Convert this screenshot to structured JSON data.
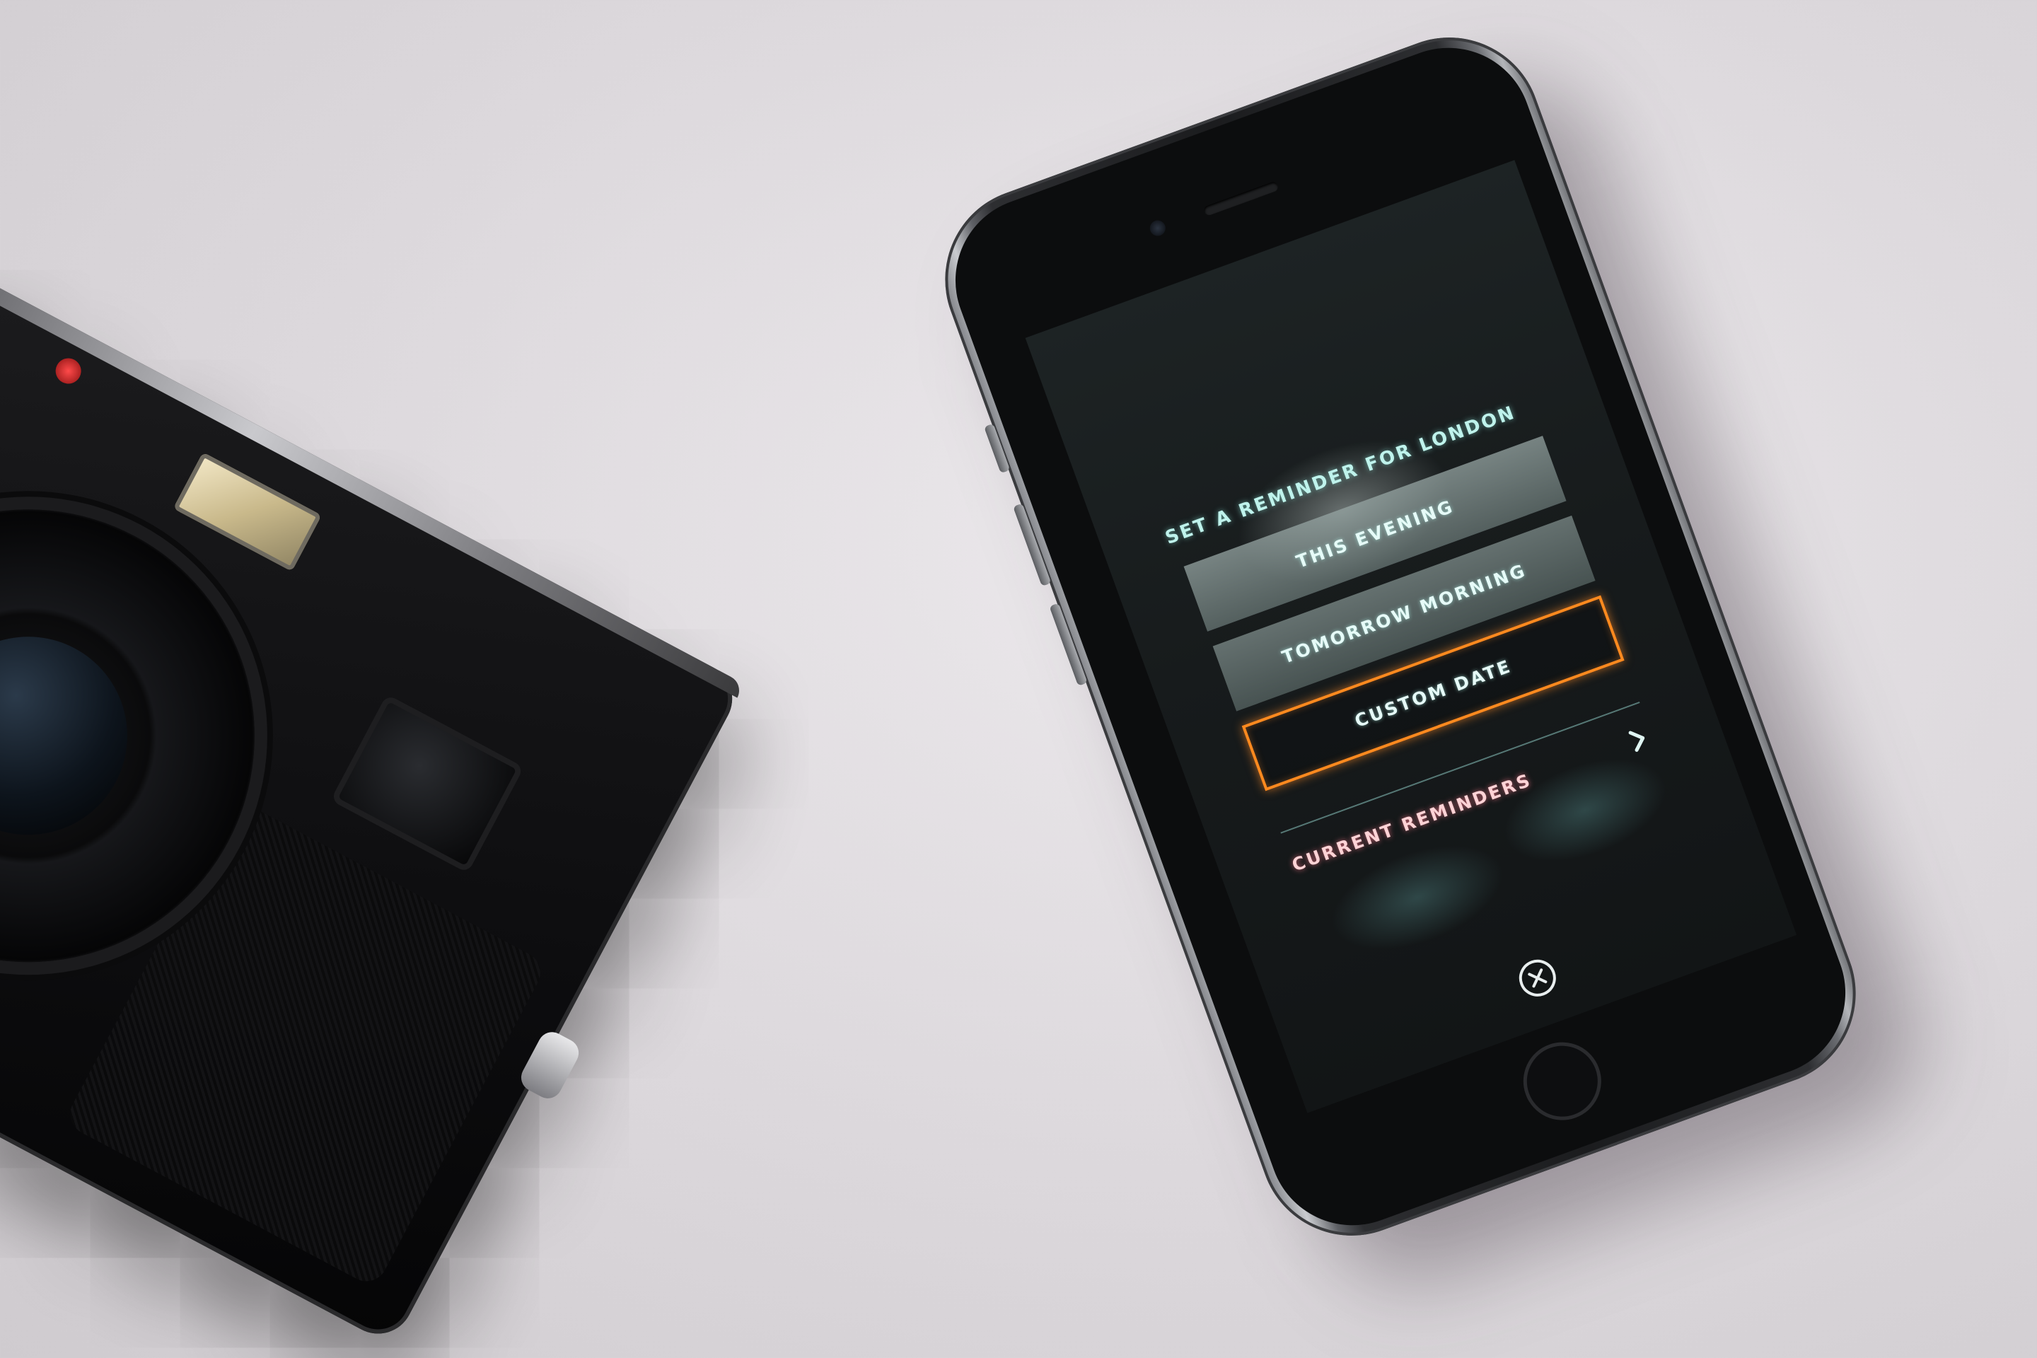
{
  "reminder_sheet": {
    "title": "SET A REMINDER FOR LONDON",
    "options": [
      {
        "label": "THIS EVENING",
        "state": "default"
      },
      {
        "label": "TOMORROW MORNING",
        "state": "default"
      },
      {
        "label": "CUSTOM DATE",
        "state": "highlighted"
      }
    ],
    "current_reminders_label": "CURRENT REMINDERS",
    "current_reminders_icon": "chevron-right-icon",
    "close_icon": "close-circle-icon"
  },
  "colors": {
    "title_text": "#bff3ec",
    "custom_date_border": "#ff8a1f",
    "current_reminders_text": "#ffd3d6",
    "screen_background": "#171b1c"
  }
}
